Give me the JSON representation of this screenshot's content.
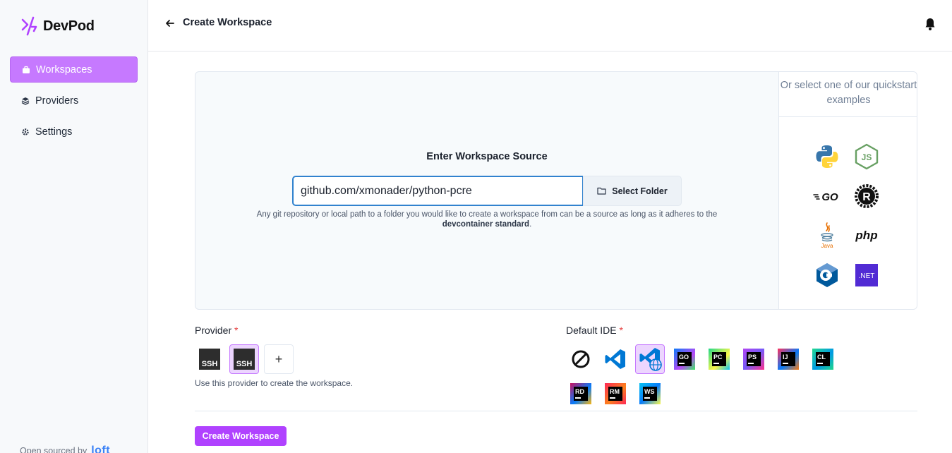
{
  "app": {
    "name": "DevPod",
    "brand_color": "#b042ff"
  },
  "sidebar": {
    "items": [
      {
        "label": "Workspaces",
        "icon": "briefcase-icon",
        "active": true
      },
      {
        "label": "Providers",
        "icon": "layers-icon",
        "active": false
      },
      {
        "label": "Settings",
        "icon": "gear-icon",
        "active": false
      }
    ],
    "footer_text": "Open sourced by",
    "footer_brand": "loft"
  },
  "header": {
    "title": "Create Workspace"
  },
  "source": {
    "title": "Enter Workspace Source",
    "value": "github.com/xmonader/python-pcre",
    "select_folder_label": "Select Folder",
    "helper_prefix": "Any git repository or local path to a folder you would like to create a workspace from can be a source as long as it adheres to the",
    "helper_link": "devcontainer standard",
    "helper_suffix": "."
  },
  "quickstart": {
    "title": "Or select one of our quickstart examples",
    "examples": [
      "python",
      "nodejs",
      "go",
      "rust",
      "java",
      "php",
      "cpp",
      "dotnet"
    ]
  },
  "provider": {
    "label": "Provider",
    "required_mark": "*",
    "options": [
      {
        "name": "ssh",
        "text": "SSH",
        "selected": false
      },
      {
        "name": "ssh",
        "text": "SSH",
        "selected": true
      }
    ],
    "add_label": "+",
    "helper": "Use this provider to create the workspace."
  },
  "ide": {
    "label": "Default IDE",
    "required_mark": "*",
    "options": [
      {
        "name": "none",
        "selected": false
      },
      {
        "name": "vscode",
        "selected": false
      },
      {
        "name": "openvscode",
        "selected": true
      },
      {
        "name": "goland",
        "abbr": "GO",
        "selected": false
      },
      {
        "name": "pycharm",
        "abbr": "PC",
        "selected": false
      },
      {
        "name": "phpstorm",
        "abbr": "PS",
        "selected": false
      },
      {
        "name": "intellij",
        "abbr": "IJ",
        "selected": false
      },
      {
        "name": "clion",
        "abbr": "CL",
        "selected": false
      },
      {
        "name": "rider",
        "abbr": "RD",
        "selected": false
      },
      {
        "name": "rubymine",
        "abbr": "RM",
        "selected": false
      },
      {
        "name": "webstorm",
        "abbr": "WS",
        "selected": false
      }
    ]
  },
  "actions": {
    "create_label": "Create Workspace"
  }
}
